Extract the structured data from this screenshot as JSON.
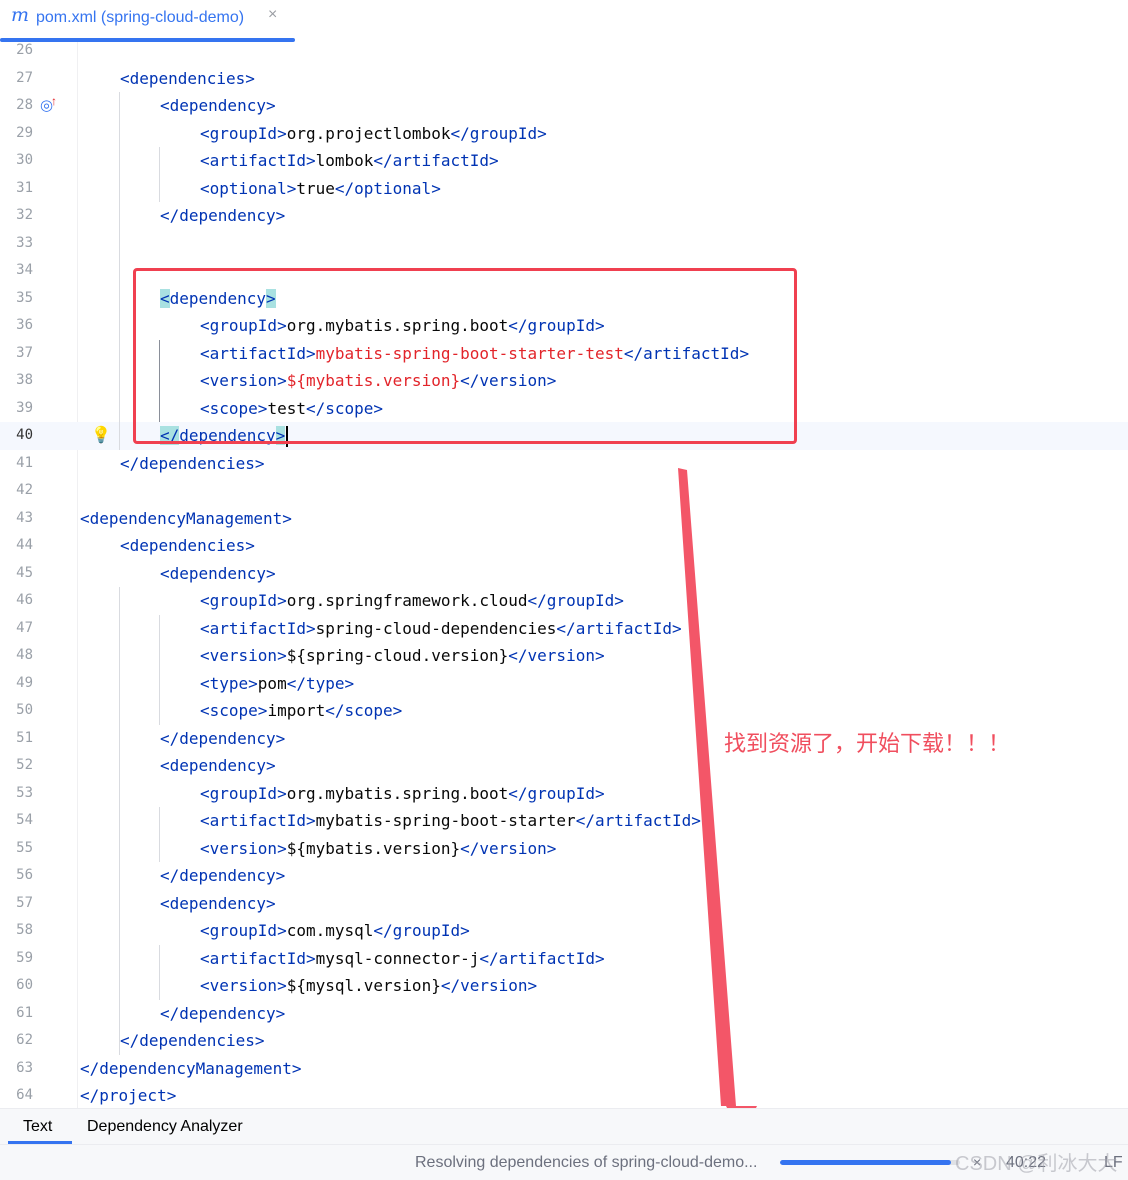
{
  "tab": {
    "icon": "m",
    "title": "pom.xml (spring-cloud-demo)",
    "close": "×"
  },
  "editor": {
    "lines": [
      {
        "n": "26",
        "indent": 0,
        "parts": []
      },
      {
        "n": "27",
        "indent": 1,
        "parts": [
          [
            "tag",
            "<dependencies>"
          ]
        ]
      },
      {
        "n": "28",
        "indent": 2,
        "parts": [
          [
            "tag",
            "<dependency>"
          ]
        ]
      },
      {
        "n": "29",
        "indent": 3,
        "parts": [
          [
            "tag",
            "<groupId>"
          ],
          [
            "txt",
            "org.projectlombok"
          ],
          [
            "tag",
            "</groupId>"
          ]
        ]
      },
      {
        "n": "30",
        "indent": 3,
        "parts": [
          [
            "tag",
            "<artifactId>"
          ],
          [
            "txt",
            "lombok"
          ],
          [
            "tag",
            "</artifactId>"
          ]
        ]
      },
      {
        "n": "31",
        "indent": 3,
        "parts": [
          [
            "tag",
            "<optional>"
          ],
          [
            "txt",
            "true"
          ],
          [
            "tag",
            "</optional>"
          ]
        ]
      },
      {
        "n": "32",
        "indent": 2,
        "parts": [
          [
            "tag",
            "</dependency>"
          ]
        ]
      },
      {
        "n": "33",
        "indent": 0,
        "parts": []
      },
      {
        "n": "34",
        "indent": 0,
        "parts": []
      },
      {
        "n": "35",
        "indent": 2,
        "parts": [
          [
            "taghl",
            "<"
          ],
          [
            "tag",
            "dependency"
          ],
          [
            "taghl",
            ">"
          ]
        ]
      },
      {
        "n": "36",
        "indent": 3,
        "parts": [
          [
            "tag",
            "<groupId>"
          ],
          [
            "txt",
            "org.mybatis.spring.boot"
          ],
          [
            "tag",
            "</groupId>"
          ]
        ]
      },
      {
        "n": "37",
        "indent": 3,
        "parts": [
          [
            "tag",
            "<artifactId>"
          ],
          [
            "red",
            "mybatis-spring-boot-starter-test"
          ],
          [
            "tag",
            "</artifactId>"
          ]
        ]
      },
      {
        "n": "38",
        "indent": 3,
        "parts": [
          [
            "tag",
            "<version>"
          ],
          [
            "red",
            "${mybatis.version}"
          ],
          [
            "tag",
            "</version>"
          ]
        ]
      },
      {
        "n": "39",
        "indent": 3,
        "parts": [
          [
            "tag",
            "<scope>"
          ],
          [
            "txt",
            "test"
          ],
          [
            "tag",
            "</scope>"
          ]
        ]
      },
      {
        "n": "40",
        "indent": 2,
        "parts": [
          [
            "taghl",
            "</"
          ],
          [
            "tag",
            "dependency"
          ],
          [
            "taghl",
            ">"
          ]
        ],
        "current": true
      },
      {
        "n": "41",
        "indent": 1,
        "parts": [
          [
            "tag",
            "</dependencies>"
          ]
        ]
      },
      {
        "n": "42",
        "indent": 0,
        "parts": []
      },
      {
        "n": "43",
        "indent": 0,
        "parts": [
          [
            "tag",
            "<dependencyManagement>"
          ]
        ]
      },
      {
        "n": "44",
        "indent": 1,
        "parts": [
          [
            "tag",
            "<dependencies>"
          ]
        ]
      },
      {
        "n": "45",
        "indent": 2,
        "parts": [
          [
            "tag",
            "<dependency>"
          ]
        ]
      },
      {
        "n": "46",
        "indent": 3,
        "parts": [
          [
            "tag",
            "<groupId>"
          ],
          [
            "txt",
            "org.springframework.cloud"
          ],
          [
            "tag",
            "</groupId>"
          ]
        ]
      },
      {
        "n": "47",
        "indent": 3,
        "parts": [
          [
            "tag",
            "<artifactId>"
          ],
          [
            "txt",
            "spring-cloud-dependencies"
          ],
          [
            "tag",
            "</artifactId>"
          ]
        ]
      },
      {
        "n": "48",
        "indent": 3,
        "parts": [
          [
            "tag",
            "<version>"
          ],
          [
            "txt",
            "${spring-cloud.version}"
          ],
          [
            "tag",
            "</version>"
          ]
        ]
      },
      {
        "n": "49",
        "indent": 3,
        "parts": [
          [
            "tag",
            "<type>"
          ],
          [
            "txt",
            "pom"
          ],
          [
            "tag",
            "</type>"
          ]
        ]
      },
      {
        "n": "50",
        "indent": 3,
        "parts": [
          [
            "tag",
            "<scope>"
          ],
          [
            "txt",
            "import"
          ],
          [
            "tag",
            "</scope>"
          ]
        ]
      },
      {
        "n": "51",
        "indent": 2,
        "parts": [
          [
            "tag",
            "</dependency>"
          ]
        ]
      },
      {
        "n": "52",
        "indent": 2,
        "parts": [
          [
            "tag",
            "<dependency>"
          ]
        ]
      },
      {
        "n": "53",
        "indent": 3,
        "parts": [
          [
            "tag",
            "<groupId>"
          ],
          [
            "txt",
            "org.mybatis.spring.boot"
          ],
          [
            "tag",
            "</groupId>"
          ]
        ]
      },
      {
        "n": "54",
        "indent": 3,
        "parts": [
          [
            "tag",
            "<artifactId>"
          ],
          [
            "txt",
            "mybatis-spring-boot-starter"
          ],
          [
            "tag",
            "</artifactId>"
          ]
        ]
      },
      {
        "n": "55",
        "indent": 3,
        "parts": [
          [
            "tag",
            "<version>"
          ],
          [
            "txt",
            "${mybatis.version}"
          ],
          [
            "tag",
            "</version>"
          ]
        ]
      },
      {
        "n": "56",
        "indent": 2,
        "parts": [
          [
            "tag",
            "</dependency>"
          ]
        ]
      },
      {
        "n": "57",
        "indent": 2,
        "parts": [
          [
            "tag",
            "<dependency>"
          ]
        ]
      },
      {
        "n": "58",
        "indent": 3,
        "parts": [
          [
            "tag",
            "<groupId>"
          ],
          [
            "txt",
            "com.mysql"
          ],
          [
            "tag",
            "</groupId>"
          ]
        ]
      },
      {
        "n": "59",
        "indent": 3,
        "parts": [
          [
            "tag",
            "<artifactId>"
          ],
          [
            "txt",
            "mysql-connector-j"
          ],
          [
            "tag",
            "</artifactId>"
          ]
        ]
      },
      {
        "n": "60",
        "indent": 3,
        "parts": [
          [
            "tag",
            "<version>"
          ],
          [
            "txt",
            "${mysql.version}"
          ],
          [
            "tag",
            "</version>"
          ]
        ]
      },
      {
        "n": "61",
        "indent": 2,
        "parts": [
          [
            "tag",
            "</dependency>"
          ]
        ]
      },
      {
        "n": "62",
        "indent": 1,
        "parts": [
          [
            "tag",
            "</dependencies>"
          ]
        ]
      },
      {
        "n": "63",
        "indent": 0,
        "parts": [
          [
            "tag",
            "</dependencyManagement>"
          ]
        ]
      },
      {
        "n": "64",
        "indent": 0,
        "parts": [
          [
            "tag",
            "</project>"
          ]
        ]
      }
    ]
  },
  "annotation": {
    "text": "找到资源了，开始下载！！！",
    "color": "#f04e5e"
  },
  "bottom_tabs": {
    "text": "Text",
    "analyzer": "Dependency Analyzer"
  },
  "status": {
    "message": "Resolving dependencies of spring-cloud-demo...",
    "progress": 0.95,
    "close": "×",
    "position": "40:22",
    "line_sep": "LF"
  },
  "watermark": "CSDN @利冰大大",
  "colors": {
    "accent": "#3574f0",
    "tag": "#0033b3",
    "error": "#e2242a",
    "highlight": "#f04050"
  }
}
